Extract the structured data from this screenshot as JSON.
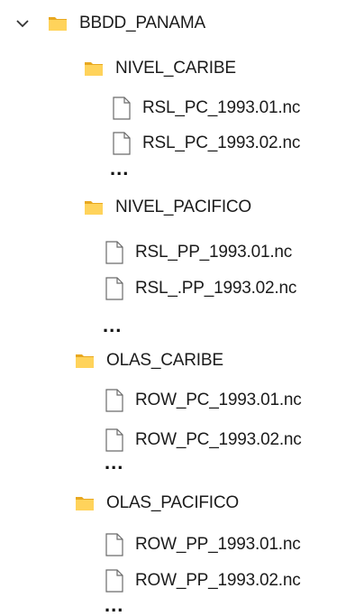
{
  "tree": {
    "root": {
      "label": "BBDD_PANAMA"
    },
    "groups": [
      {
        "label": "NIVEL_CARIBE",
        "files": [
          "RSL_PC_1993.01.nc",
          "RSL_PC_1993.02.nc"
        ],
        "more": "..."
      },
      {
        "label": "NIVEL_PACIFICO",
        "files": [
          "RSL_PP_1993.01.nc",
          "RSL_.PP_1993.02.nc"
        ],
        "more": "..."
      },
      {
        "label": "OLAS_CARIBE",
        "files": [
          "ROW_PC_1993.01.nc",
          "ROW_PC_1993.02.nc"
        ],
        "more": "..."
      },
      {
        "label": "OLAS_PACIFICO",
        "files": [
          "ROW_PP_1993.01.nc",
          "ROW_PP_1993.02.nc"
        ],
        "more": "..."
      }
    ]
  },
  "colors": {
    "folder_front": "#FFD35B",
    "folder_back": "#E8A820",
    "file_stroke": "#6b6b6b"
  }
}
